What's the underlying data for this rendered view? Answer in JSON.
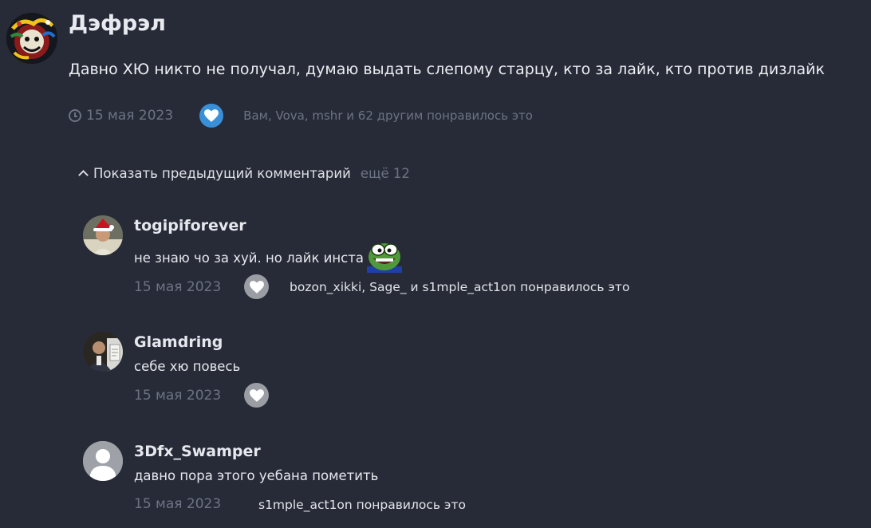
{
  "post": {
    "author": "Дэфрэл",
    "text": "Давно ХЮ никто не получал, думаю выдать слепому старцу, кто за лайк, кто против дизлайк",
    "date": "15 мая 2023",
    "likes_text": "Вам, Vova, mshr и 62 другим понравилось это",
    "liked": true,
    "like_color": "#3a8fd9",
    "icons": {
      "date": "clock-icon",
      "like": "heart-icon"
    }
  },
  "show_previous": {
    "label": "Показать предыдущий комментарий",
    "count": "ещё 12",
    "icon": "chevron-up-icon"
  },
  "comments": [
    {
      "author": "togipiforever",
      "text": "не знаю чо за хуй. но лайк инста",
      "emoji": "pepe-emoji",
      "date": "15 мая 2023",
      "likes_text": "bozon_xikki, Sage_ и s1mple_act1on понравилось это",
      "has_like_button": true
    },
    {
      "author": "Glamdring",
      "text": "себе хю повесь",
      "date": "15 мая 2023",
      "likes_text": "",
      "has_like_button": true
    },
    {
      "author": "3Dfx_Swamper",
      "text": "давно пора этого уебана пометить",
      "date": "15 мая 2023",
      "likes_text": "s1mple_act1on понравилось это",
      "has_like_button": false,
      "avatar": "default-user-icon"
    }
  ],
  "colors": {
    "background": "#272b37",
    "muted_text": "#6c7384",
    "like_inactive": "#9a9da4",
    "like_active": "#3a8fd9"
  }
}
